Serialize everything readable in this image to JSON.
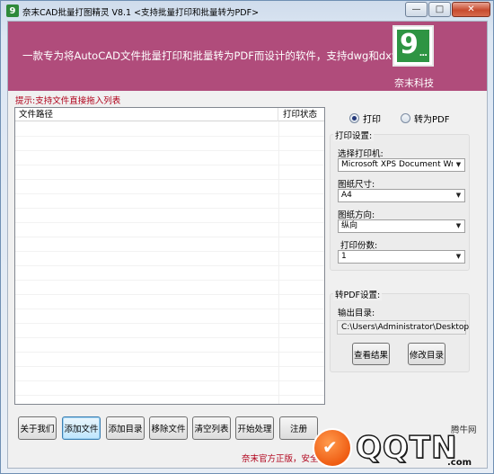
{
  "window": {
    "title": "奈末CAD批量打图精灵 V8.1    <支持批量打印和批量转为PDF>",
    "app_icon_glyph": "9",
    "minimize_glyph": "—",
    "maximize_glyph": "□",
    "close_glyph": "✕"
  },
  "banner": {
    "text": "一款专为将AutoCAD文件批量打印和批量转为PDF而设计的软件，支持dwg和dxf",
    "logo_glyph": "9",
    "logo_dots": "...",
    "brand": "奈末科技",
    "background": "#b04c7b",
    "logo_color": "#2e9443"
  },
  "hint": "提示:支持文件直接拖入列表",
  "file_list": {
    "columns": [
      "文件路径",
      "打印状态"
    ],
    "rows": []
  },
  "mode": {
    "options": [
      {
        "label": "打印",
        "checked": true
      },
      {
        "label": "转为PDF",
        "checked": false
      }
    ]
  },
  "print_settings": {
    "group_title": "打印设置:",
    "printer_label": "选择打印机:",
    "printer_value": "Microsoft XPS Document Write",
    "paper_label": "图纸尺寸:",
    "paper_value": "A4",
    "orientation_label": "图纸方向:",
    "orientation_value": "纵向",
    "copies_label": "打印份数:",
    "copies_value": "1",
    "dropdown_glyph": "▼"
  },
  "pdf_settings": {
    "group_title": "转PDF设置:",
    "output_label": "输出目录:",
    "output_value": "C:\\Users\\Administrator\\Desktop",
    "view_result_button": "查看结果",
    "change_dir_button": "修改目录"
  },
  "toolbar": {
    "about": "关于我们",
    "add_files": "添加文件",
    "add_folder": "添加目录",
    "remove_files": "移除文件",
    "clear_list": "清空列表",
    "start": "开始处理",
    "register": "注册"
  },
  "footer": "奈末官方正版，安全放心",
  "watermark": {
    "tag": "腾牛网",
    "logo": "QQTN",
    "domain": ".com",
    "check_glyph": "✔"
  }
}
